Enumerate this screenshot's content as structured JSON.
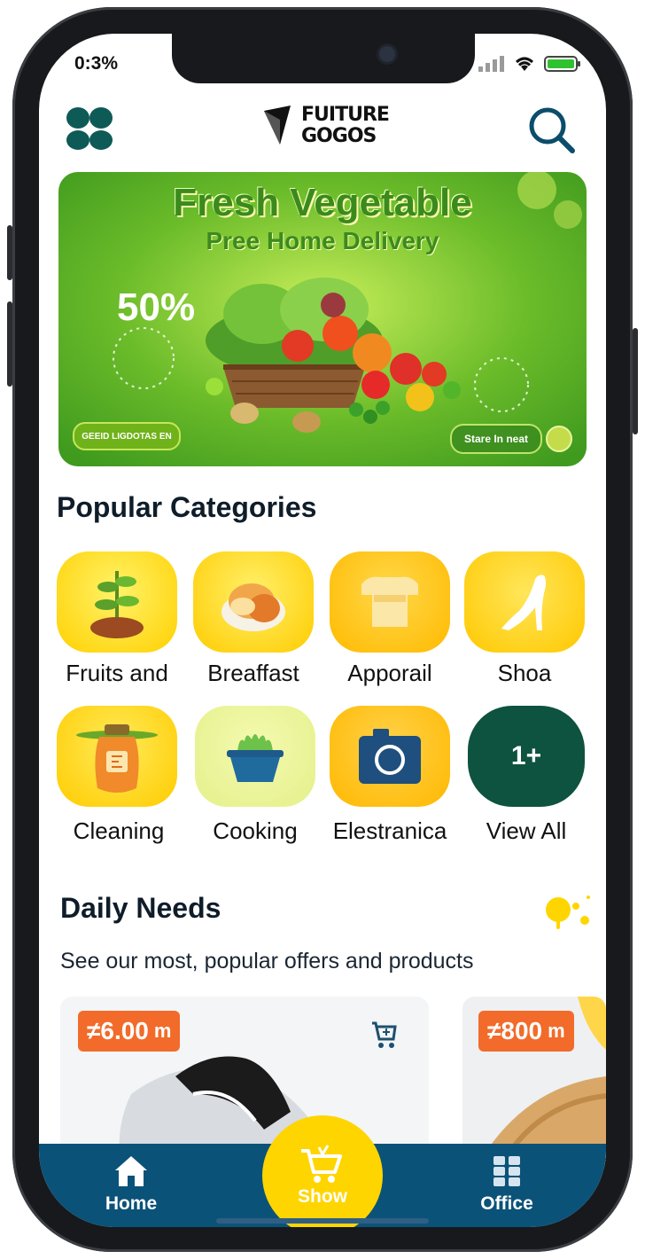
{
  "status_bar": {
    "time": "0:3%"
  },
  "header": {
    "brand_line1": "FUITURE",
    "brand_line2": "GOGOS"
  },
  "banner": {
    "title": "Fresh Vegetable",
    "subtitle": "Pree Home Delivery",
    "discount": "50%",
    "pill_label": "GEEID LIGDOTAS EN",
    "store_label": "Stare In neat"
  },
  "categories_section": {
    "title": "Popular Categories",
    "items": [
      {
        "label": "Fruits and",
        "icon": "plant-icon"
      },
      {
        "label": "Breaffast",
        "icon": "bread-icon"
      },
      {
        "label": "Apporail",
        "icon": "shirt-icon"
      },
      {
        "label": "Shoa",
        "icon": "heel-shoe-icon"
      },
      {
        "label": "Cleaning",
        "icon": "cleaning-bottle-icon"
      },
      {
        "label": "Cooking",
        "icon": "pot-icon"
      },
      {
        "label": "Elestranica",
        "icon": "camera-icon"
      },
      {
        "label": "View All",
        "icon_text": "1+"
      }
    ]
  },
  "daily_needs": {
    "title": "Daily Needs",
    "subtitle": "See our most, popular offers and products",
    "products": [
      {
        "price": "≠6.00",
        "unit": "m",
        "image": "sneaker"
      },
      {
        "price": "≠800",
        "unit": "m",
        "image": "bread"
      }
    ]
  },
  "bottom_nav": {
    "home": "Home",
    "center": "Show",
    "office": "Office"
  },
  "colors": {
    "nav_bg": "#0b5279",
    "accent_yellow": "#ffd500",
    "price_orange": "#f26b2a",
    "view_all_green": "#0e5240",
    "logo_teal": "#0e5a56"
  }
}
